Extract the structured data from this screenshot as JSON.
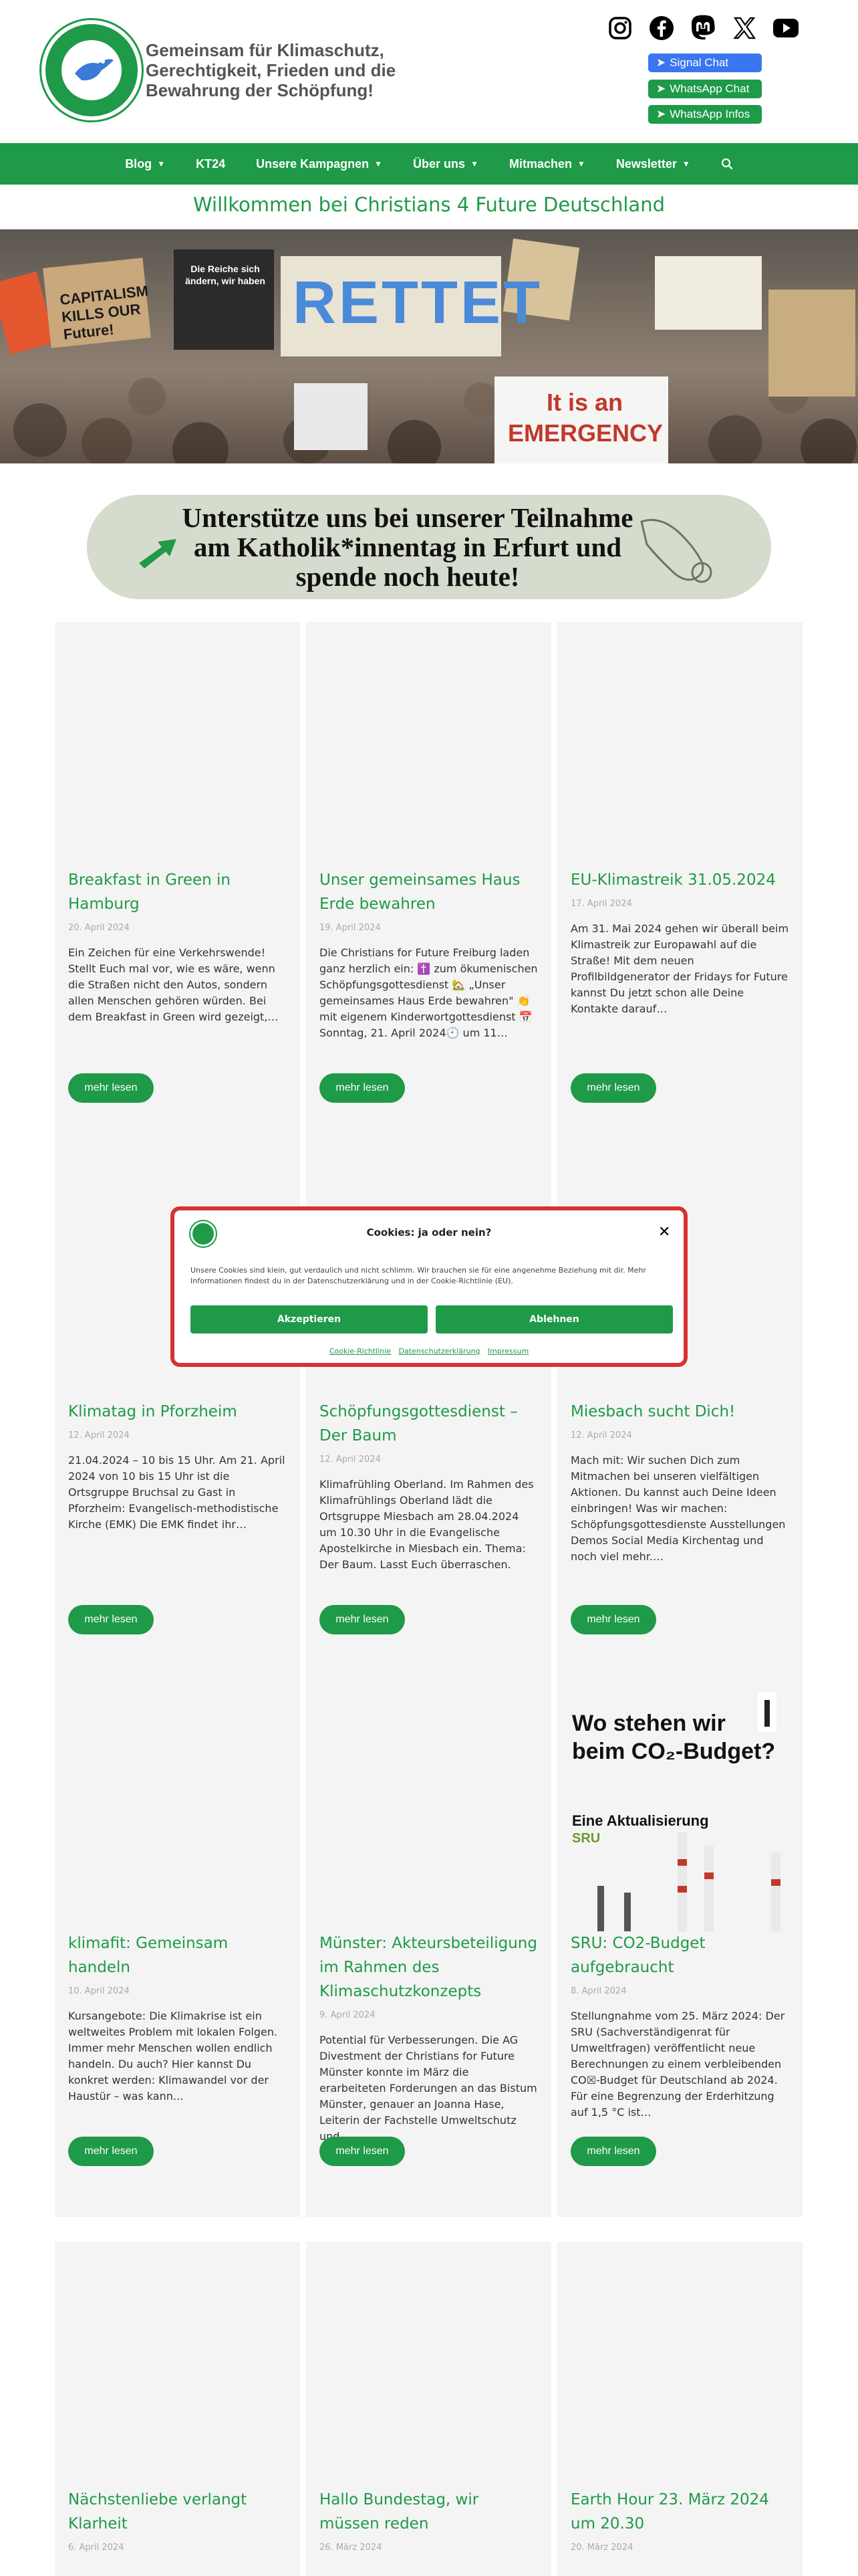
{
  "header": {
    "tagline": [
      "Gemeinsam  für  Klimaschutz,",
      "Gerechtigkeit, Frieden und die",
      "Bewahrung der Schöpfung!"
    ],
    "social_icons": [
      "instagram-icon",
      "facebook-icon",
      "mastodon-icon",
      "x-icon",
      "youtube-icon"
    ],
    "chat_buttons": [
      "Signal Chat",
      "WhatsApp Chat",
      "WhatsApp Infos"
    ]
  },
  "nav": {
    "items": [
      {
        "label": "Blog",
        "dropdown": true
      },
      {
        "label": "KT24",
        "dropdown": false
      },
      {
        "label": "Unsere Kampagnen",
        "dropdown": true
      },
      {
        "label": "Über uns",
        "dropdown": true
      },
      {
        "label": "Mitmachen",
        "dropdown": true
      },
      {
        "label": "Newsletter",
        "dropdown": true
      }
    ],
    "search_icon": "search-icon"
  },
  "welcome": "Willkommen bei Christians 4 Future Deutschland",
  "hero": {
    "signs": [
      "CAPITALISM KILLS OUR Future!",
      "It is an EMERGENCY",
      "RETTET",
      "Die Reiche sich ändern, wir haben"
    ]
  },
  "banner": {
    "text": "Unterstütze uns bei unserer Teilnahme am Katholik*innentag in Erfurt und spende noch heute!"
  },
  "posts": [
    {
      "title": "Breakfast in Green in Hamburg",
      "date": "20. April 2024",
      "excerpt": "Ein Zeichen für eine Verkehrswende! Stellt Euch mal vor, wie es wäre, wenn die Straßen nicht den Autos, sondern allen Menschen gehören würden. Bei dem Breakfast in Green wird gezeigt,…"
    },
    {
      "title": "Unser gemeinsames Haus Erde bewahren",
      "date": "19. April 2024",
      "excerpt": "Die Christians for Future Freiburg laden ganz herzlich ein: ✝️ zum ökumenischen Schöpfungsgottesdienst 🏡 „Unser gemeinsames Haus Erde bewahren\" 👏 mit eigenem Kinderwortgottesdienst 📅 Sonntag, 21. April 2024🕙 um 11…"
    },
    {
      "title": "EU-Klimastreik 31.05.2024",
      "date": "17. April 2024",
      "excerpt": "Am 31. Mai 2024 gehen wir überall beim Klimastreik zur Europawahl auf die Straße! Mit dem neuen Profilbildgenerator der Fridays for Future kannst Du jetzt schon alle Deine Kontakte darauf…"
    },
    {
      "title": "Klimatag in Pforzheim",
      "date": "12. April 2024",
      "excerpt": "21.04.2024 – 10 bis 15 Uhr. Am 21. April 2024 von 10 bis 15 Uhr ist die Ortsgruppe Bruchsal zu Gast in Pforzheim: Evangelisch-methodistische Kirche (EMK) Die EMK findet ihr…"
    },
    {
      "title": "Schöpfungsgottesdienst – Der Baum",
      "date": "12. April 2024",
      "excerpt": "Klimafrühling Oberland. Im Rahmen des Klimafrühlings Oberland lädt die Ortsgruppe Miesbach am 28.04.2024 um 10.30 Uhr in die Evangelische Apostelkirche in Miesbach ein. Thema: Der Baum. Lasst Euch überraschen."
    },
    {
      "title": "Miesbach sucht Dich!",
      "date": "12. April 2024",
      "excerpt": "Mach mit: Wir suchen Dich zum Mitmachen bei unseren vielfältigen Aktionen. Du kannst auch Deine Ideen einbringen! Was wir machen: Schöpfungsgottesdienste Ausstellungen Demos Social Media Kirchentag und noch viel mehr.…"
    },
    {
      "title": "klimafit: Gemeinsam handeln",
      "date": "10. April 2024",
      "excerpt": "Kursangebote: Die Klimakrise ist ein weltweites Problem mit lokalen Folgen. Immer mehr Menschen wollen endlich handeln. Du auch? Hier kannst Du konkret werden: Klimawandel vor der Haustür – was kann…"
    },
    {
      "title": "Münster: Akteursbeteiligung im Rahmen des Klimaschutzkonzepts",
      "date": "9. April 2024",
      "excerpt": "Potential für Verbesserungen. Die AG Divestment der Christians for Future Münster konnte im März die erarbeiteten Forderungen an das Bistum Münster, genauer an Joanna Hase, Leiterin der Fachstelle Umweltschutz und…"
    },
    {
      "title": "SRU: CO2-Budget aufgebraucht",
      "date": "8. April 2024",
      "excerpt": "Stellungnahme vom 25. März 2024: Der SRU (Sachverständigenrat für Umweltfragen) veröffentlicht neue Berechnungen zu einem verbleibenden CO☒-Budget für Deutschland ab 2024. Für eine Begrenzung der Erderhitzung auf 1,5 °C ist…"
    },
    {
      "title": "Nächstenliebe verlangt Klarheit",
      "date": "6. April 2024",
      "excerpt": ""
    },
    {
      "title": "Hallo Bundestag, wir müssen reden",
      "date": "26. März 2024",
      "excerpt": ""
    },
    {
      "title": "Earth Hour 23. März 2024 um 20.30",
      "date": "20. März 2024",
      "excerpt": ""
    }
  ],
  "more_label": "mehr lesen",
  "co2_image": {
    "title_line1": "Wo stehen wir",
    "title_line2": "beim CO₂-Budget?",
    "subtitle": "Eine Aktualisierung",
    "logo": "SRU"
  },
  "cookie": {
    "title": "Cookies: ja oder nein?",
    "text": "Unsere Cookies  sind klein, gut verdaulich und nicht schlimm. Wir brauchen sie für eine angenehme Beziehung mit dir. Mehr Informationen findest du in der Datenschutzerklärung und in der Cookie-Richtlinie (EU).",
    "accept": "Akzeptieren",
    "decline": "Ablehnen",
    "links": [
      "Cookie-Richtlinie",
      "Datenschutzerklärung",
      "Impressum"
    ],
    "close": "✕"
  },
  "colors": {
    "brand_green": "#1e9a48",
    "signal_blue": "#3a76f0",
    "cookie_border": "#d83232"
  }
}
